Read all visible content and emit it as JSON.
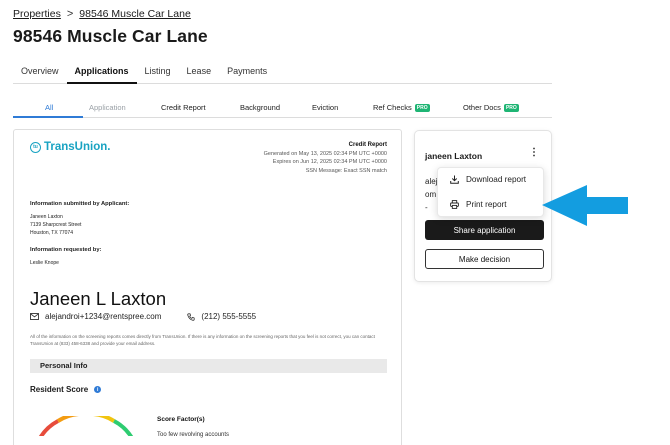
{
  "breadcrumb": {
    "root": "Properties",
    "separator": ">",
    "current": "98546 Muscle Car Lane"
  },
  "page": {
    "title": "98546 Muscle Car Lane"
  },
  "main_tabs": [
    {
      "label": "Overview"
    },
    {
      "label": "Applications"
    },
    {
      "label": "Listing"
    },
    {
      "label": "Lease"
    },
    {
      "label": "Payments"
    }
  ],
  "sub_tabs": {
    "all": "All",
    "application": "Application",
    "credit": "Credit Report",
    "background": "Background",
    "eviction": "Eviction",
    "ref_checks": "Ref Checks",
    "other_docs": "Other Docs",
    "pro_badge": "PRO"
  },
  "report": {
    "logo_text": "TransUnion.",
    "logo_mark": "tu",
    "title": "Credit Report",
    "generated": "Generated on May 13, 2025 02:34 PM UTC +0000",
    "expires": "Expires on Jun 12, 2025 02:34 PM UTC +0000",
    "ssn_message": "SSN Message: Exact SSN match",
    "submitted_header": "Information submitted by Applicant:",
    "submitted_name": "Janeen Laxton",
    "submitted_street": "7139 Sharpcrest Street",
    "submitted_city": "Houston, TX 77074",
    "requested_header": "Information requested by:",
    "requested_name": "Leslie Knope",
    "applicant_name": "Janeen L Laxton",
    "email": "alejandroi+1234@rentspree.com",
    "phone": "(212) 555-5555",
    "disclaimer": "All of the information on the screening reports comes directly from TransUnion. If there is any information on the screening reports that you feel is not correct, you can contact TransUnion at (833) 458-6338 and provide your email address.",
    "section_personal": "Personal Info",
    "resident_score_label": "Resident Score",
    "info_glyph": "i",
    "score_factors_label": "Score Factor(s)",
    "score_reason": "Too few revolving accounts"
  },
  "applicant_panel": {
    "name": "janeen Laxton",
    "menu_glyph": "⋮",
    "email_frag_1": "alej",
    "email_frag_2": "om",
    "email_frag_3": "-",
    "share_label": "Share application",
    "decision_label": "Make decision"
  },
  "dropdown": {
    "download_label": "Download report",
    "print_label": "Print report"
  },
  "colors": {
    "accent": "#2f7bd6",
    "transunion": "#19a3c2",
    "pro": "#1fb574",
    "arrow": "#139de0",
    "dark_button": "#1a1a1a"
  }
}
